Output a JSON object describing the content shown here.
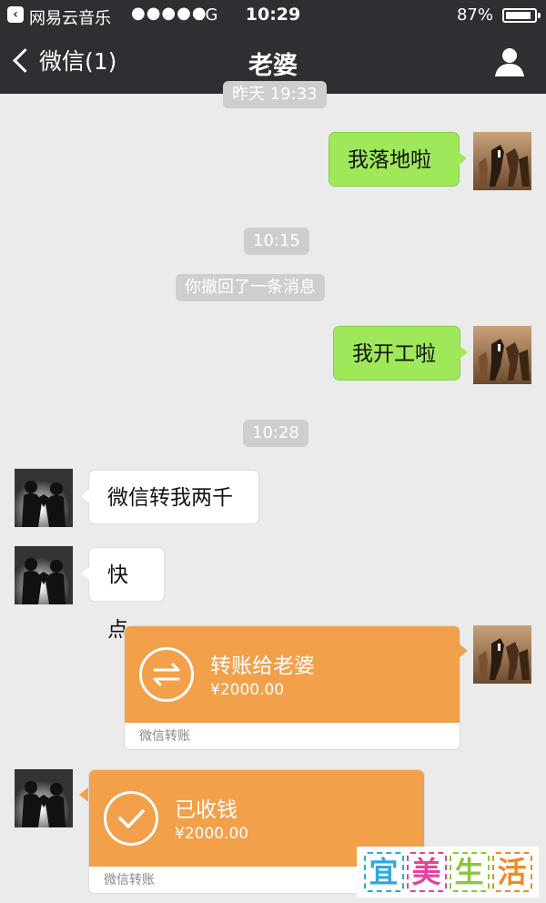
{
  "status_bar": {
    "app_name": "网易云音乐",
    "signal": "●●●●●",
    "network": "4G",
    "time": "10:29",
    "battery": "87%"
  },
  "nav": {
    "back_label": "微信(1)",
    "title": "老婆"
  },
  "timestamps": [
    "昨天 19:33",
    "10:15",
    "10:28"
  ],
  "system_notice": "你撤回了一条消息",
  "messages": {
    "m1": "我落地啦",
    "m2": "我开工啦",
    "m3": "微信转我两千",
    "m4": "快点"
  },
  "transfer_sent": {
    "title": "转账给老婆",
    "amount": "¥2000.00",
    "footer": "微信转账"
  },
  "transfer_received": {
    "title": "已收钱",
    "amount": "¥2000.00",
    "footer": "微信转账"
  },
  "watermark": {
    "chars": [
      "宜",
      "美",
      "生",
      "活"
    ]
  },
  "colors": {
    "topbar": "#2e2f33",
    "background": "#ebebeb",
    "bubble_sent": "#9fe85a",
    "transfer": "#f2a04a"
  }
}
